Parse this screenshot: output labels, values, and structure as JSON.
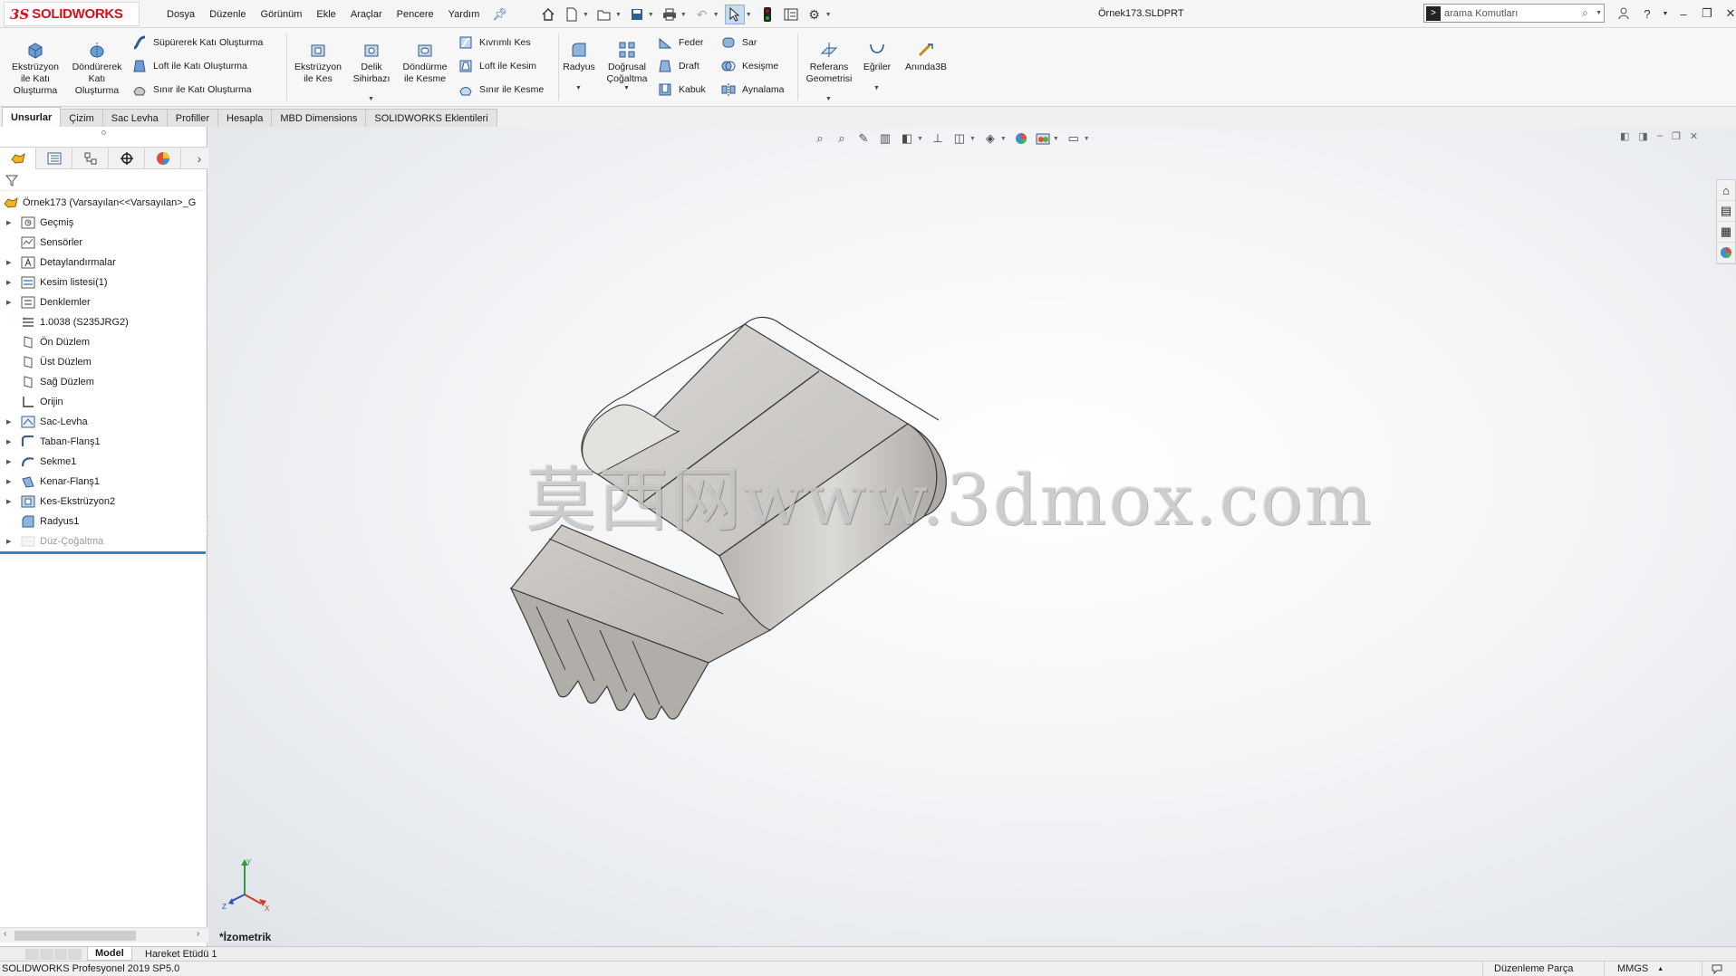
{
  "app": {
    "brand": "SOLIDWORKS",
    "document_title": "Örnek173.SLDPRT"
  },
  "menu": [
    "Dosya",
    "Düzenle",
    "Görünüm",
    "Ekle",
    "Araçlar",
    "Pencere",
    "Yardım"
  ],
  "search": {
    "placeholder": "arama Komutları"
  },
  "ribbon": {
    "extrude_boss": "Ekstrüzyon ile Katı Oluşturma",
    "revolve_boss": "Döndürerek Katı Oluşturma",
    "swept_boss": "Süpürerek Katı Oluşturma",
    "loft_boss": "Loft ile Katı Oluşturma",
    "boundary_boss": "Sınır ile Katı Oluşturma",
    "extrude_cut": "Ekstrüzyon ile Kes",
    "hole_wizard": "Delik Sihirbazı",
    "revolve_cut": "Döndürme ile Kesme",
    "swept_cut": "Kıvrımlı Kes",
    "loft_cut": "Loft ile Kesim",
    "boundary_cut": "Sınır ile Kesme",
    "fillet": "Radyus",
    "linear_pattern": "Doğrusal Çoğaltma",
    "rib": "Feder",
    "draft": "Draft",
    "shell": "Kabuk",
    "wrap": "Sar",
    "intersect": "Kesişme",
    "mirror": "Aynalama",
    "ref_geometry": "Referans Geometrisi",
    "curves": "Eğriler",
    "instant3d": "Anında3B"
  },
  "tabs": [
    "Unsurlar",
    "Çizim",
    "Sac Levha",
    "Profiller",
    "Hesapla",
    "MBD Dimensions",
    "SOLIDWORKS Eklentileri"
  ],
  "active_tab": "Unsurlar",
  "tree": {
    "root": "Örnek173  (Varsayılan<<Varsayılan>_G",
    "items": [
      {
        "label": "Geçmiş",
        "icon": "history-icon",
        "expandable": true
      },
      {
        "label": "Sensörler",
        "icon": "sensor-icon",
        "expandable": false
      },
      {
        "label": "Detaylandırmalar",
        "icon": "annotations-icon",
        "expandable": true
      },
      {
        "label": "Kesim listesi(1)",
        "icon": "cut-list-icon",
        "expandable": true
      },
      {
        "label": "Denklemler",
        "icon": "equations-icon",
        "expandable": true
      },
      {
        "label": "1.0038 (S235JRG2)",
        "icon": "material-icon",
        "expandable": false
      },
      {
        "label": "Ön Düzlem",
        "icon": "plane-icon",
        "expandable": false
      },
      {
        "label": "Üst Düzlem",
        "icon": "plane-icon",
        "expandable": false
      },
      {
        "label": "Sağ Düzlem",
        "icon": "plane-icon",
        "expandable": false
      },
      {
        "label": "Orijin",
        "icon": "origin-icon",
        "expandable": false
      },
      {
        "label": "Sac-Levha",
        "icon": "sheet-metal-icon",
        "expandable": true
      },
      {
        "label": "Taban-Flanş1",
        "icon": "base-flange-icon",
        "expandable": true
      },
      {
        "label": "Sekme1",
        "icon": "tab-feature-icon",
        "expandable": true
      },
      {
        "label": "Kenar-Flanş1",
        "icon": "edge-flange-icon",
        "expandable": true
      },
      {
        "label": "Kes-Ekstrüzyon2",
        "icon": "cut-extrude-icon",
        "expandable": true
      },
      {
        "label": "Radyus1",
        "icon": "fillet-icon",
        "expandable": false
      },
      {
        "label": "Düz-Çoğaltma",
        "icon": "flat-pattern-icon",
        "expandable": true,
        "suppressed": true
      }
    ]
  },
  "viewport": {
    "view_name": "*İzometrik",
    "watermark": "莫西网www.3dmox.com",
    "triad_labels": {
      "x": "X",
      "y": "Y",
      "z": "Z"
    }
  },
  "bottom_tabs": [
    "Model",
    "Hareket Etüdü 1"
  ],
  "status": {
    "left": "SOLIDWORKS Profesyonel 2019 SP5.0",
    "mode": "Düzenleme Parça",
    "units": "MMGS"
  },
  "colors": {
    "accent_blue": "#3c7fc1",
    "brand_red": "#d0111b",
    "part_gray": "#c9c6c2"
  }
}
